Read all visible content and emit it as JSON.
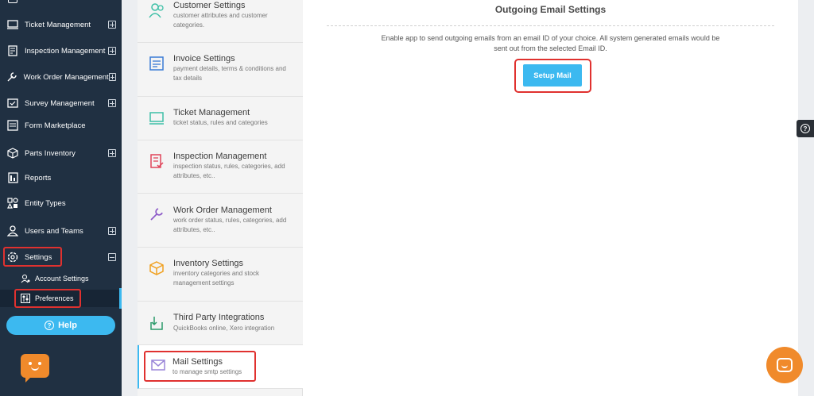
{
  "sidebar": {
    "items": [
      {
        "label": "Ticket Management",
        "icon": "ticket-icon"
      },
      {
        "label": "Inspection Management",
        "icon": "inspection-icon"
      },
      {
        "label": "Work Order Management",
        "icon": "wrench-icon"
      },
      {
        "label": "Survey Management",
        "icon": "survey-icon"
      },
      {
        "label": "Form Marketplace",
        "icon": "form-icon"
      },
      {
        "label": "Parts Inventory",
        "icon": "box-icon"
      },
      {
        "label": "Reports",
        "icon": "reports-icon"
      },
      {
        "label": "Entity Types",
        "icon": "shapes-icon"
      },
      {
        "label": "Users and Teams",
        "icon": "user-icon"
      },
      {
        "label": "Settings",
        "icon": "gear-icon"
      }
    ],
    "sub_items": [
      {
        "label": "Account Settings",
        "icon": "account-settings-icon"
      },
      {
        "label": "Preferences",
        "icon": "preferences-icon"
      }
    ],
    "help_label": "Help"
  },
  "settings_list": [
    {
      "title": "Customer Settings",
      "desc": "customer attributes and customer categories.",
      "icon": "customer-icon"
    },
    {
      "title": "Invoice Settings",
      "desc": "payment details, terms & conditions and tax details",
      "icon": "invoice-icon"
    },
    {
      "title": "Ticket Management",
      "desc": "ticket status, rules and categories",
      "icon": "ticket-icon"
    },
    {
      "title": "Inspection Management",
      "desc": "inspection status, rules, categories, add attributes, etc..",
      "icon": "inspection-icon"
    },
    {
      "title": "Work Order Management",
      "desc": "work order status, rules, categories, add attributes, etc..",
      "icon": "wrench-icon"
    },
    {
      "title": "Inventory Settings",
      "desc": "inventory categories and stock management settings",
      "icon": "box-icon"
    },
    {
      "title": "Third Party Integrations",
      "desc": "QuickBooks online, Xero integration",
      "icon": "integration-icon"
    },
    {
      "title": "Mail Settings",
      "desc": "to manage smtp settings",
      "icon": "mail-icon"
    }
  ],
  "main": {
    "title": "Outgoing Email Settings",
    "description": "Enable app to send outgoing emails from an email ID of your choice. All system generated emails would be sent out from the selected Email ID.",
    "setup_button": "Setup Mail"
  },
  "colors": {
    "sidebar_bg": "#203042",
    "accent": "#3cb9f0",
    "highlight": "#e0312f",
    "chat": "#f08a2b"
  }
}
